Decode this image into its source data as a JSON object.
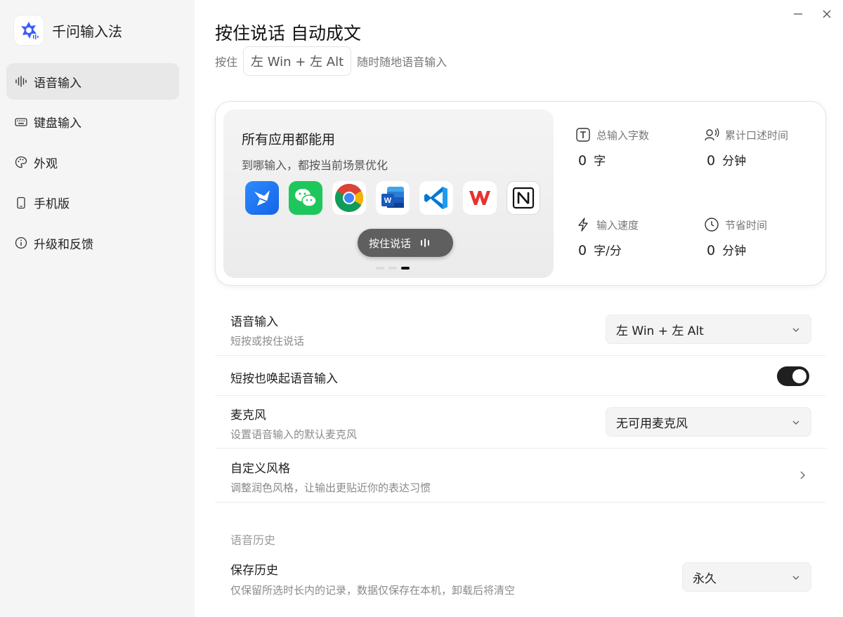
{
  "sidebar": {
    "app_name": "千问输入法",
    "items": [
      {
        "label": "语音输入",
        "icon": "waveform-icon",
        "active": true
      },
      {
        "label": "键盘输入",
        "icon": "keyboard-icon",
        "active": false
      },
      {
        "label": "外观",
        "icon": "palette-icon",
        "active": false
      },
      {
        "label": "手机版",
        "icon": "phone-icon",
        "active": false
      },
      {
        "label": "升级和反馈",
        "icon": "info-icon",
        "active": false
      }
    ]
  },
  "window": {
    "minimize_icon": "minimize-icon",
    "close_icon": "close-icon"
  },
  "header": {
    "title": "按住说话 自动成文",
    "subtitle_prefix": "按住",
    "hotkey": "左 Win + 左 Alt",
    "subtitle_suffix": "随时随地语音输入"
  },
  "promo": {
    "title": "所有应用都能用",
    "desc": "到哪输入，都按当前场景优化",
    "apps": [
      "feishu-app-icon",
      "wechat-app-icon",
      "chrome-app-icon",
      "word-app-icon",
      "vscode-app-icon",
      "wps-app-icon",
      "notion-app-icon"
    ],
    "ptt_label": "按住说话",
    "carousel_pages": 3,
    "carousel_active": 3
  },
  "stats": {
    "total_chars": {
      "label": "总输入字数",
      "value": "0",
      "unit": "字"
    },
    "dictation_time": {
      "label": "累计口述时间",
      "value": "0",
      "unit": "分钟"
    },
    "input_speed": {
      "label": "输入速度",
      "value": "0",
      "unit": "字/分"
    },
    "time_saved": {
      "label": "节省时间",
      "value": "0",
      "unit": "分钟"
    }
  },
  "settings": {
    "voice_input": {
      "title": "语音输入",
      "desc": "短按或按住说话",
      "value": "左 Win + 左 Alt"
    },
    "short_press": {
      "title": "短按也唤起语音输入",
      "enabled": true
    },
    "microphone": {
      "title": "麦克风",
      "desc": "设置语音输入的默认麦克风",
      "value": "无可用麦克风"
    },
    "custom_style": {
      "title": "自定义风格",
      "desc": "调整润色风格，让输出更贴近你的表达习惯"
    },
    "history_section": "语音历史",
    "save_history": {
      "title": "保存历史",
      "desc": "仅保留所选时长内的记录，数据仅保存在本机，卸载后将清空",
      "value": "永久"
    }
  },
  "colors": {
    "sidebar_bg": "#f5f5f5",
    "active_item": "#e8e8e8",
    "toggle_on": "#1f1f1f",
    "logo_blue": "#3b5bfd"
  }
}
